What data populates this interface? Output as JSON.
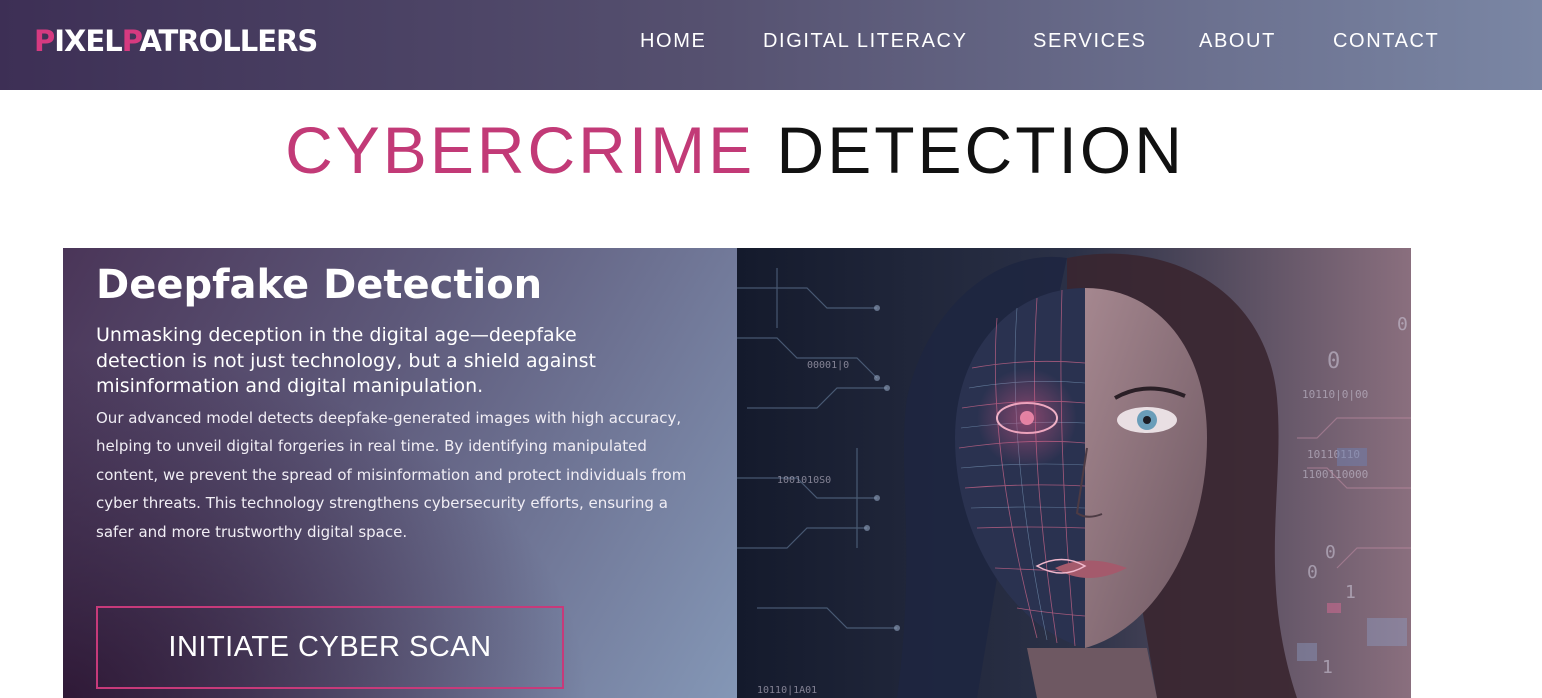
{
  "brand": {
    "logo_p1": "P",
    "logo_w1": "IXEL",
    "logo_p2": "P",
    "logo_w2": "ATROLLERS"
  },
  "nav": {
    "home": "HOME",
    "digital_literacy": "DIGITAL LITERACY",
    "services": "SERVICES",
    "about": "ABOUT",
    "contact": "CONTACT"
  },
  "page": {
    "heading_accent": "CYBERCRIME",
    "heading_rest": "DETECTION"
  },
  "card": {
    "title": "Deepfake Detection",
    "lead": "Unmasking deception in the digital age—deepfake detection is not just technology, but a shield against misinformation and digital manipulation.",
    "body": "Our advanced model detects deepfake-generated images with high accuracy, helping to unveil digital forgeries in real time. By identifying manipulated content, we prevent the spread of misinformation and protect individuals from cyber threats. This technology strengthens cybersecurity efforts, ensuring a safer and more trustworthy digital space.",
    "cta": "INITIATE CYBER SCAN"
  },
  "colors": {
    "accent": "#c23a77",
    "nav_start": "#3d2f55",
    "nav_end": "#7a86a4"
  },
  "hero_image": {
    "icon": "deepfake-face-image"
  }
}
